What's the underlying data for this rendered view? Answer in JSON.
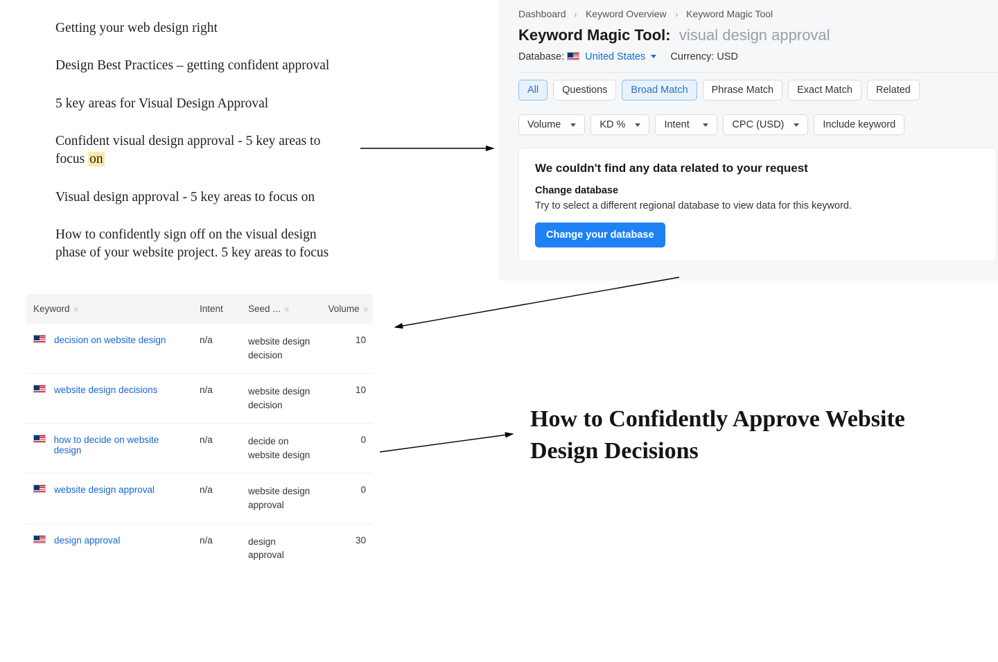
{
  "headlines": [
    {
      "text": "Getting your web design right"
    },
    {
      "text": "Design Best Practices – getting confident approval"
    },
    {
      "text": "5 key areas for Visual Design Approval"
    },
    {
      "text_before": "Confident visual design approval - 5 key areas to focus ",
      "highlight": "on"
    },
    {
      "text": "Visual design approval - 5 key areas to focus on"
    },
    {
      "text": "How to confidently sign off on the visual design phase of your website project. 5 key areas to focus"
    }
  ],
  "kmt": {
    "breadcrumb": [
      "Dashboard",
      "Keyword Overview",
      "Keyword Magic Tool"
    ],
    "title_label": "Keyword Magic Tool:",
    "term": "visual design approval",
    "database_label": "Database:",
    "database_value": "United States",
    "currency_label": "Currency:",
    "currency_value": "USD",
    "match_tabs": [
      "All",
      "Questions",
      "Broad Match",
      "Phrase Match",
      "Exact Match",
      "Related"
    ],
    "match_selected": [
      "All",
      "Broad Match"
    ],
    "filters": [
      "Volume",
      "KD %",
      "Intent",
      "CPC (USD)",
      "Include keyword"
    ],
    "empty_title": "We couldn't find any data related to your request",
    "empty_sub1": "Change database",
    "empty_sub2": "Try to select a different regional database to view data for this keyword.",
    "empty_cta": "Change your database"
  },
  "table": {
    "headers": {
      "keyword": "Keyword",
      "intent": "Intent",
      "seed": "Seed ...",
      "volume": "Volume"
    },
    "rows": [
      {
        "keyword": "decision on website design",
        "intent": "n/a",
        "seed": "website design decision",
        "volume": "10"
      },
      {
        "keyword": "website design decisions",
        "intent": "n/a",
        "seed": "website design decision",
        "volume": "10"
      },
      {
        "keyword": "how to decide on website design",
        "intent": "n/a",
        "seed": "decide on website design",
        "volume": "0"
      },
      {
        "keyword": "website design approval",
        "intent": "n/a",
        "seed": "website design approval",
        "volume": "0"
      },
      {
        "keyword": "design approval",
        "intent": "n/a",
        "seed": "design approval",
        "volume": "30"
      }
    ]
  },
  "big_title": "How to Confidently Approve Website Design Decisions"
}
